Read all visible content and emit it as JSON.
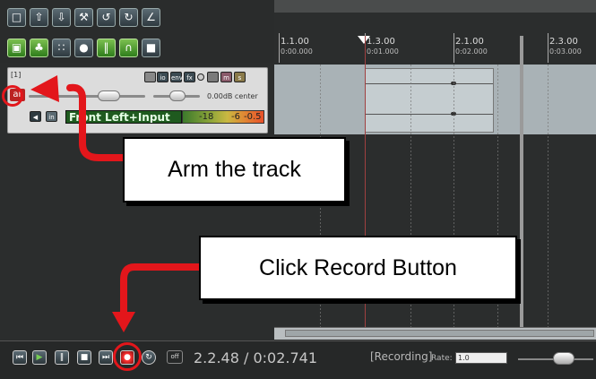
{
  "track": {
    "number": "[1]",
    "arm_label": "ar",
    "volume_readout": "0.00dB center",
    "input_source": "Front Left+Input",
    "in_label": "in",
    "fx_buttons": [
      "io",
      "env",
      "fx"
    ],
    "m_label": "m",
    "s_label": "s",
    "meter_ticks": [
      "-18",
      "-6",
      "-0.5"
    ]
  },
  "ruler": {
    "markers": [
      {
        "bar": "1.1.00",
        "time": "0:00.000"
      },
      {
        "bar": "1.3.00",
        "time": "0:01.000"
      },
      {
        "bar": "2.1.00",
        "time": "0:02.000"
      },
      {
        "bar": "2.3.00",
        "time": "0:03.000"
      }
    ]
  },
  "transport": {
    "position": "2.2.48 / 0:02.741",
    "status": "[Recording]",
    "rate_label": "Rate:",
    "rate_value": "1.0",
    "off_label": "off"
  },
  "callouts": {
    "arm": "Arm the track",
    "record": "Click Record Button"
  },
  "colors": {
    "annotation_red": "#e3161b",
    "arm_active": "#b22222"
  }
}
